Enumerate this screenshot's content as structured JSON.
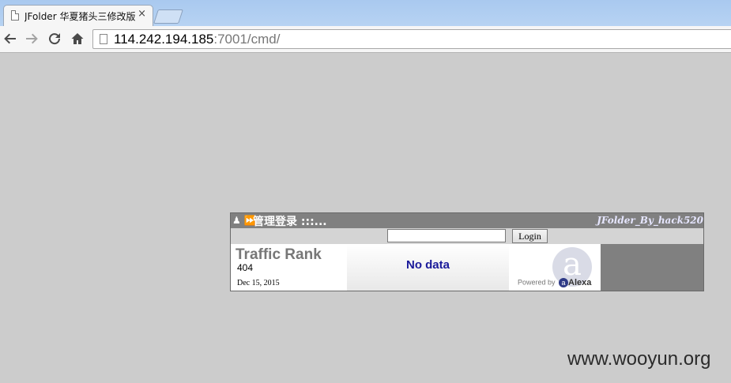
{
  "browser": {
    "tab_title": "JFolder 华夏猪头三修改版",
    "tab_close": "×",
    "url_host": "114.242.194.185",
    "url_rest": ":7001/cmd/",
    "icons": {
      "back": "back-arrow-icon",
      "forward": "forward-arrow-icon",
      "reload": "reload-icon",
      "home": "home-icon",
      "page": "page-icon"
    }
  },
  "panel": {
    "header_icon": "♟ ⏩",
    "header_title": "管理登录 :::...",
    "brand": "JFolder_By_hack520",
    "login_input_value": "",
    "login_button": "Login"
  },
  "alexa": {
    "title": "Traffic Rank",
    "rank": "404",
    "date": "Dec 15, 2015",
    "graph_text": "No data",
    "logo_letter": "a",
    "powered_by": "Powered by",
    "brand_mark": "a",
    "brand_name": "Alexa"
  },
  "watermark": "www.wooyun.org",
  "colors": {
    "page_bg": "#cccccc",
    "panel_bg": "#808080",
    "login_row_bg": "#d4d4d4",
    "nodata_text": "#1a1a9a"
  }
}
